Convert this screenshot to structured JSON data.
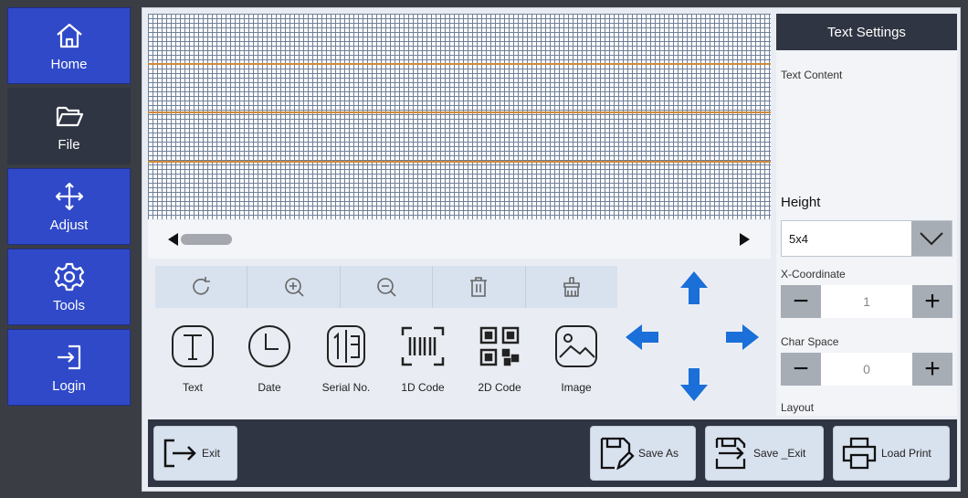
{
  "sidebar": {
    "items": [
      {
        "label": "Home",
        "icon": "home-icon"
      },
      {
        "label": "File",
        "icon": "folder-icon"
      },
      {
        "label": "Adjust",
        "icon": "move-icon"
      },
      {
        "label": "Tools",
        "icon": "gear-icon"
      },
      {
        "label": "Login",
        "icon": "login-icon"
      }
    ],
    "active": "File"
  },
  "toolbar": {
    "tools": [
      "rotate-icon",
      "zoom-in-icon",
      "zoom-out-icon",
      "delete-icon",
      "clear-icon"
    ]
  },
  "insert": {
    "items": [
      {
        "label": "Text",
        "icon": "text-icon"
      },
      {
        "label": "Date",
        "icon": "clock-icon"
      },
      {
        "label": "Serial No.",
        "icon": "serial-icon"
      },
      {
        "label": "1D Code",
        "icon": "barcode-icon"
      },
      {
        "label": "2D Code",
        "icon": "qrcode-icon"
      },
      {
        "label": "Image",
        "icon": "image-icon"
      }
    ]
  },
  "settings": {
    "title": "Text Settings",
    "text_content_label": "Text Content",
    "height_label": "Height",
    "height_value": "5x4",
    "x_coordinate_label": "X-Coordinate",
    "x_coordinate_value": "1",
    "char_space_label": "Char Space",
    "char_space_value": "0",
    "layout_label": "Layout"
  },
  "bottom": {
    "exit_label": "Exit",
    "save_as_label": "Save As",
    "save_exit_label": "Save _Exit",
    "load_print_label": "Load Print"
  },
  "colors": {
    "nav_blue": "#2f49c8",
    "dark": "#2f3542",
    "arrow_blue": "#1a6fd8",
    "guide_orange": "#d08a3c"
  }
}
